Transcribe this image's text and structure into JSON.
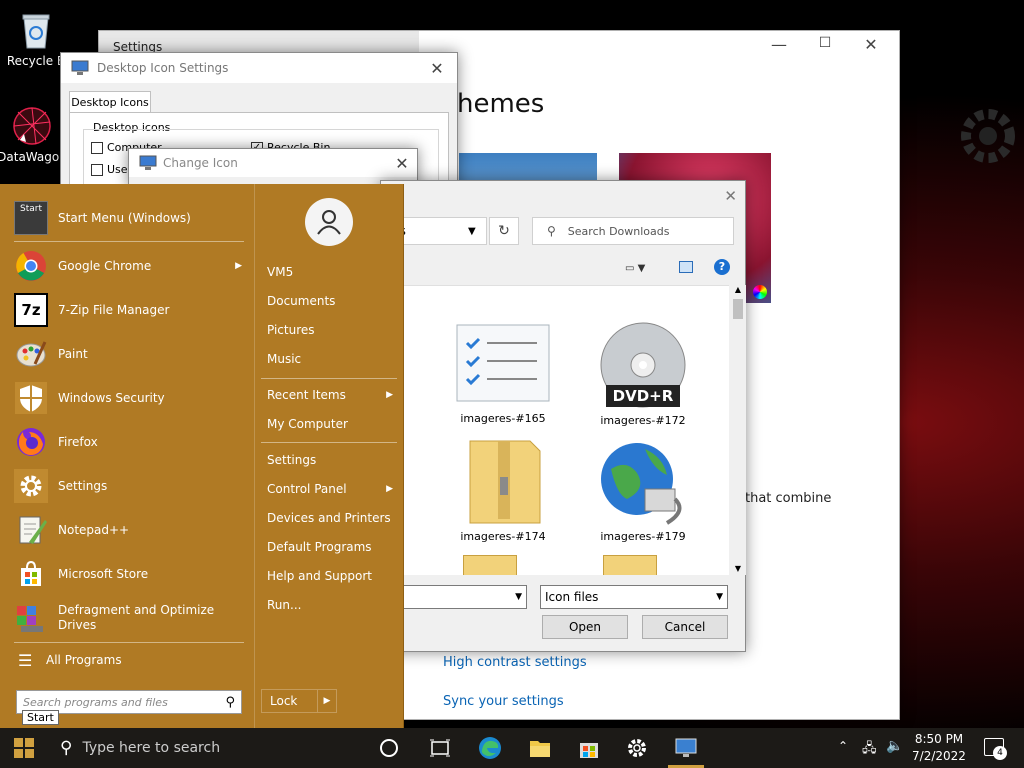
{
  "desktop": {
    "icons": [
      {
        "label": "Recycle B",
        "icon": "recycle-bin-icon"
      },
      {
        "label": "DataWagon",
        "icon": "datawagon-icon"
      }
    ]
  },
  "settings_window": {
    "title": "Settings",
    "heading": "hemes",
    "text_fragment": "that combine",
    "link_high_contrast": "High contrast settings",
    "link_sync": "Sync your settings"
  },
  "desktop_icon_settings": {
    "title": "Desktop Icon Settings",
    "tab": "Desktop Icons",
    "group": "Desktop icons",
    "checkboxes": [
      {
        "label": "Computer",
        "checked": false
      },
      {
        "label": "User",
        "checked": false
      },
      {
        "label": "Recycle Bin",
        "checked": true
      }
    ]
  },
  "change_icon": {
    "title": "Change Icon"
  },
  "file_dialog": {
    "address_fragment": "ds",
    "search_placeholder": "Search Downloads",
    "files": [
      {
        "name": "imageres-#165",
        "icon": "checklist-icon"
      },
      {
        "name": "imageres-#172",
        "icon": "dvd-r-icon",
        "badge": "DVD+R"
      },
      {
        "name": "imageres-#174",
        "icon": "zip-folder-icon"
      },
      {
        "name": "imageres-#179",
        "icon": "network-globe-icon"
      }
    ],
    "filter": "Icon files",
    "open_label": "Open",
    "cancel_label": "Cancel"
  },
  "start_menu": {
    "items": [
      {
        "label": "Start Menu (Windows)",
        "icon": "start-menu-icon",
        "icon_text": "Start"
      },
      {
        "label": "Google Chrome",
        "icon": "chrome-icon",
        "submenu": true
      },
      {
        "label": "7-Zip File Manager",
        "icon": "seven-zip-icon",
        "icon_text": "7z"
      },
      {
        "label": "Paint",
        "icon": "paint-icon"
      },
      {
        "label": "Windows Security",
        "icon": "shield-icon"
      },
      {
        "label": "Firefox",
        "icon": "firefox-icon"
      },
      {
        "label": "Settings",
        "icon": "gear-icon"
      },
      {
        "label": "Notepad++",
        "icon": "notepad-plus-icon"
      },
      {
        "label": "Microsoft Store",
        "icon": "store-icon"
      },
      {
        "label": "Defragment and Optimize Drives",
        "icon": "defrag-icon"
      }
    ],
    "all_programs": "All Programs",
    "search_placeholder": "Search programs and files",
    "tooltip": "Start",
    "right": {
      "user": "VM5",
      "documents": "Documents",
      "pictures": "Pictures",
      "music": "Music",
      "recent_items": "Recent Items",
      "my_computer": "My Computer",
      "settings": "Settings",
      "control_panel": "Control Panel",
      "devices_printers": "Devices and Printers",
      "default_programs": "Default Programs",
      "help_support": "Help and Support",
      "run": "Run..."
    },
    "lock": "Lock"
  },
  "taskbar": {
    "search_placeholder": "Type here to search",
    "time": "8:50 PM",
    "date": "7/2/2022",
    "notifications": "4"
  }
}
